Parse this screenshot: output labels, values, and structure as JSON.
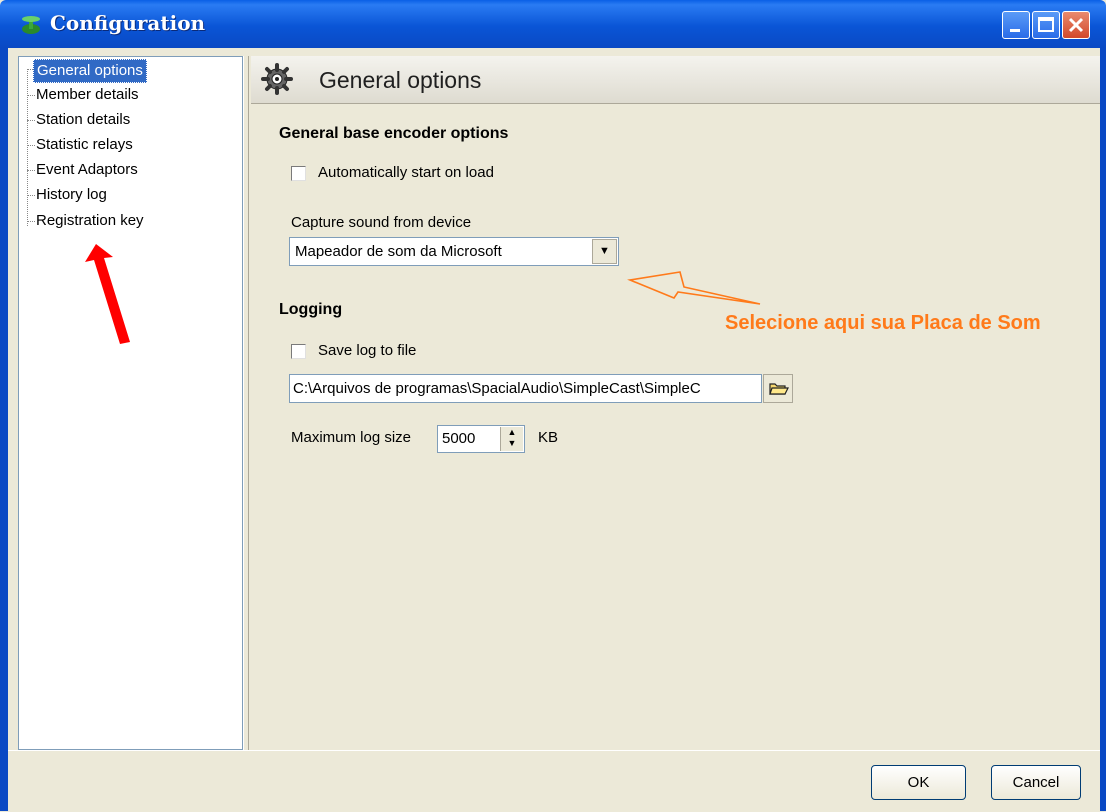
{
  "window": {
    "title": "Configuration"
  },
  "sidebar": {
    "items": [
      {
        "label": "General options",
        "selected": true
      },
      {
        "label": "Member details"
      },
      {
        "label": "Station details"
      },
      {
        "label": "Statistic relays"
      },
      {
        "label": "Event Adaptors"
      },
      {
        "label": "History log"
      },
      {
        "label": "Registration key"
      }
    ]
  },
  "main": {
    "header_title": "General options",
    "header_icon": "gear-icon",
    "encoder_section": {
      "title": "General base encoder options",
      "auto_start_label": "Automatically start on load",
      "auto_start_checked": false,
      "capture_label": "Capture sound from device",
      "capture_device": "Mapeador de som da Microsoft"
    },
    "logging_section": {
      "title": "Logging",
      "save_log_label": "Save log to file",
      "save_log_checked": false,
      "log_path": "C:\\Arquivos de programas\\SpacialAudio\\SimpleCast\\SimpleC",
      "max_log_label": "Maximum log size",
      "max_log_value": "5000",
      "max_log_unit": "KB"
    }
  },
  "annotation": {
    "text": "Selecione aqui sua Placa de Som",
    "color": "#ff7a1a"
  },
  "arrow_color": "#ff0000",
  "buttons": {
    "ok": "OK",
    "cancel": "Cancel"
  }
}
